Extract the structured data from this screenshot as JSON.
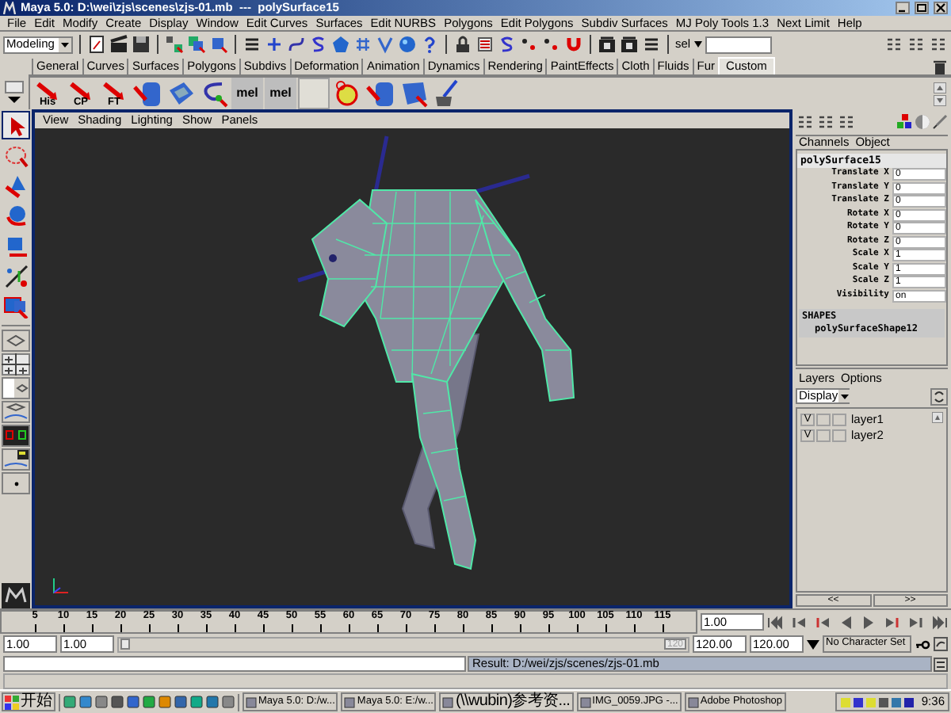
{
  "window": {
    "title": "Maya 5.0: D:\\wei\\zjs\\scenes\\zjs-01.mb  ---  polySurface15"
  },
  "menu_bar": [
    "File",
    "Edit",
    "Modify",
    "Create",
    "Display",
    "Window",
    "Edit Curves",
    "Surfaces",
    "Edit NURBS",
    "Polygons",
    "Edit Polygons",
    "Subdiv Surfaces",
    "MJ Poly Tools 1.3",
    "Next Limit",
    "Help"
  ],
  "status_line": {
    "mode": "Modeling",
    "selection_label": "sel"
  },
  "shelf": {
    "tabs": [
      {
        "label": "General",
        "selected": false
      },
      {
        "label": "Curves",
        "selected": false
      },
      {
        "label": "Surfaces",
        "selected": false
      },
      {
        "label": "Polygons",
        "selected": false
      },
      {
        "label": "Subdivs",
        "selected": false
      },
      {
        "label": "Deformation",
        "selected": false
      },
      {
        "label": "Animation",
        "selected": false
      },
      {
        "label": "Dynamics",
        "selected": false
      },
      {
        "label": "Rendering",
        "selected": false
      },
      {
        "label": "PaintEffects",
        "selected": false
      },
      {
        "label": "Cloth",
        "selected": false
      },
      {
        "label": "Fluids",
        "selected": false
      },
      {
        "label": "Fur",
        "selected": false
      },
      {
        "label": "Custom",
        "selected": true
      }
    ],
    "buttons": [
      "His",
      "CP",
      "FT",
      "mel",
      "mel"
    ]
  },
  "toolbox": {
    "tools": [
      {
        "selected": true
      },
      {
        "selected": false
      },
      {
        "selected": false
      },
      {
        "selected": false
      },
      {
        "selected": false
      },
      {
        "selected": false
      },
      {
        "selected": false
      }
    ]
  },
  "viewport": {
    "menu": [
      "View",
      "Shading",
      "Lighting",
      "Show",
      "Panels"
    ]
  },
  "channel_box": {
    "menu": [
      "Channels",
      "Object"
    ],
    "object": "polySurface15",
    "channels": [
      {
        "name": "Translate X",
        "value": "0"
      },
      {
        "name": "Translate Y",
        "value": "0"
      },
      {
        "name": "Translate Z",
        "value": "0"
      },
      {
        "name": "Rotate X",
        "value": "0"
      },
      {
        "name": "Rotate Y",
        "value": "0"
      },
      {
        "name": "Rotate Z",
        "value": "0"
      },
      {
        "name": "Scale X",
        "value": "1"
      },
      {
        "name": "Scale Y",
        "value": "1"
      },
      {
        "name": "Scale Z",
        "value": "1"
      },
      {
        "name": "Visibility",
        "value": "on"
      }
    ],
    "shapes_heading": "SHAPES",
    "shape": "polySurfaceShape12"
  },
  "layers": {
    "menu": [
      "Layers",
      "Options"
    ],
    "mode": "Display",
    "items": [
      {
        "visibility": "V",
        "name": "layer1"
      },
      {
        "visibility": "V",
        "name": "layer2"
      }
    ],
    "page_buttons": [
      "<<",
      ">>"
    ]
  },
  "time_slider": {
    "ticks": [
      "5",
      "10",
      "15",
      "20",
      "25",
      "30",
      "35",
      "40",
      "45",
      "50",
      "55",
      "60",
      "65",
      "70",
      "75",
      "80",
      "85",
      "90",
      "95",
      "100",
      "105",
      "110",
      "115"
    ],
    "current_time": "1.00"
  },
  "range_slider": {
    "start": "1.00",
    "playback_start": "1.00",
    "slider_end": "120",
    "playback_end": "120.00",
    "end": "120.00",
    "character_set": "No Character Set"
  },
  "command_line": {
    "result": "Result: D:/wei/zjs/scenes/zjs-01.mb"
  },
  "taskbar": {
    "start": "开始",
    "tasks": [
      "Maya 5.0: D:/w...",
      "Maya 5.0: E:/w...",
      "(\\\\wubin)参考资...",
      "IMG_0059.JPG -...",
      "Adobe Photoshop"
    ],
    "clock": "9:36"
  }
}
